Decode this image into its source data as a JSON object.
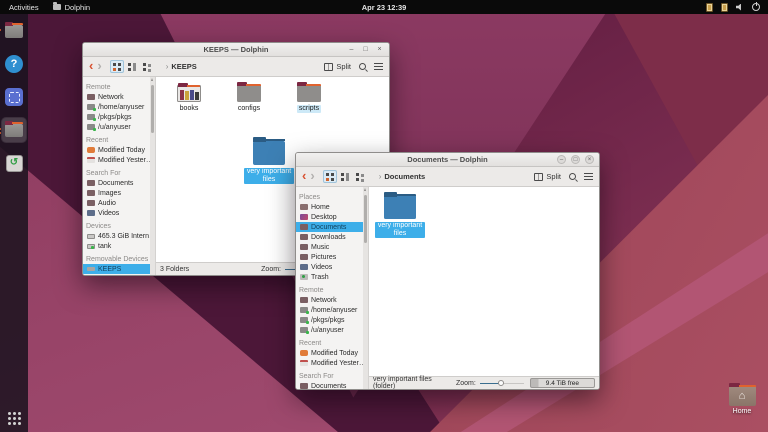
{
  "topbar": {
    "activities": "Activities",
    "window_app": "Dolphin",
    "clock": "Apr 23 12:39",
    "tray_icons": [
      "tray-applet-1",
      "tray-applet-2",
      "volume-icon",
      "power-icon"
    ]
  },
  "dock": {
    "help_glyph": "?",
    "trash_glyph": "↺",
    "items": [
      "file-manager",
      "help",
      "screenshot-tool",
      "dolphin",
      "trash"
    ]
  },
  "window1": {
    "title": "KEEPS — Dolphin",
    "breadcrumb": "KEEPS",
    "split_label": "Split",
    "sidebar": [
      {
        "type": "header",
        "label": "Remote"
      },
      {
        "type": "item",
        "label": "Network",
        "icon": "folder-net"
      },
      {
        "type": "item",
        "label": "/home/anyuser",
        "icon": "folder-sync"
      },
      {
        "type": "item",
        "label": "/pkgs/pkgs",
        "icon": "folder-sync"
      },
      {
        "type": "item",
        "label": "/u/anyuser",
        "icon": "folder-sync"
      },
      {
        "type": "header",
        "label": "Recent"
      },
      {
        "type": "item",
        "label": "Modified Today",
        "icon": "clock"
      },
      {
        "type": "item",
        "label": "Modified Yester…",
        "icon": "calendar"
      },
      {
        "type": "header",
        "label": "Search For"
      },
      {
        "type": "item",
        "label": "Documents",
        "icon": "folder-docs"
      },
      {
        "type": "item",
        "label": "Images",
        "icon": "folder-img"
      },
      {
        "type": "item",
        "label": "Audio",
        "icon": "folder-audio"
      },
      {
        "type": "item",
        "label": "Videos",
        "icon": "folder-vid"
      },
      {
        "type": "header",
        "label": "Devices"
      },
      {
        "type": "item",
        "label": "465.3 GiB Intern…",
        "icon": "drive"
      },
      {
        "type": "item",
        "label": "tank",
        "icon": "drive-tank"
      },
      {
        "type": "header",
        "label": "Removable Devices"
      },
      {
        "type": "item",
        "label": "KEEPS",
        "icon": "usb",
        "selected": true
      }
    ],
    "files": [
      {
        "label": "books",
        "icon": "folder-books"
      },
      {
        "label": "configs",
        "icon": "folder-std"
      },
      {
        "label": "scripts",
        "icon": "folder-std",
        "hover": true
      }
    ],
    "drag_item": {
      "label": "very important files"
    },
    "status": {
      "info": "3 Folders",
      "zoom_label": "Zoom:"
    }
  },
  "window2": {
    "title": "Documents — Dolphin",
    "breadcrumb": "Documents",
    "split_label": "Split",
    "sidebar": [
      {
        "type": "header",
        "label": "Places"
      },
      {
        "type": "item",
        "label": "Home",
        "icon": "folder-home"
      },
      {
        "type": "item",
        "label": "Desktop",
        "icon": "desktop"
      },
      {
        "type": "item",
        "label": "Documents",
        "icon": "folder-docs",
        "selected": true
      },
      {
        "type": "item",
        "label": "Downloads",
        "icon": "folder-std"
      },
      {
        "type": "item",
        "label": "Music",
        "icon": "folder-audio"
      },
      {
        "type": "item",
        "label": "Pictures",
        "icon": "folder-img"
      },
      {
        "type": "item",
        "label": "Videos",
        "icon": "folder-vid"
      },
      {
        "type": "item",
        "label": "Trash",
        "icon": "trash"
      },
      {
        "type": "header",
        "label": "Remote"
      },
      {
        "type": "item",
        "label": "Network",
        "icon": "folder-net"
      },
      {
        "type": "item",
        "label": "/home/anyuser",
        "icon": "folder-sync"
      },
      {
        "type": "item",
        "label": "/pkgs/pkgs",
        "icon": "folder-sync"
      },
      {
        "type": "item",
        "label": "/u/anyuser",
        "icon": "folder-sync"
      },
      {
        "type": "header",
        "label": "Recent"
      },
      {
        "type": "item",
        "label": "Modified Today",
        "icon": "clock"
      },
      {
        "type": "item",
        "label": "Modified Yester…",
        "icon": "calendar"
      },
      {
        "type": "header",
        "label": "Search For"
      },
      {
        "type": "item",
        "label": "Documents",
        "icon": "folder-docs"
      }
    ],
    "files": [
      {
        "label": "very important files",
        "icon": "folder-blue",
        "selected": true
      }
    ],
    "status": {
      "info": "very important files (folder)",
      "zoom_label": "Zoom:",
      "free": "9.4 TiB free"
    }
  },
  "desktop": {
    "home_label": "Home"
  }
}
